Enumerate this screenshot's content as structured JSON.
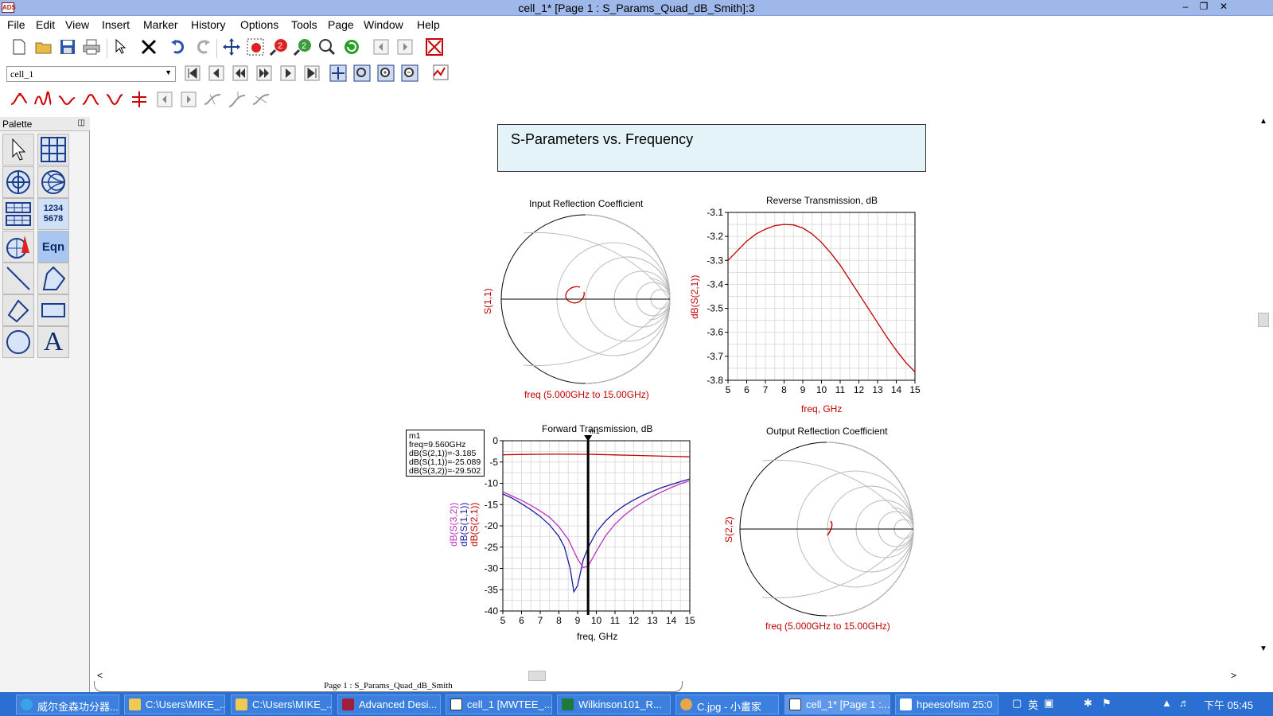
{
  "window": {
    "title": "cell_1* [Page 1 : S_Params_Quad_dB_Smith]:3",
    "app_icon": "ADS"
  },
  "menu": [
    "File",
    "Edit",
    "View",
    "Insert",
    "Marker",
    "History",
    "Options",
    "Tools",
    "Page",
    "Window",
    "Help"
  ],
  "toolbar2": {
    "cell_select": "cell_1"
  },
  "palette": {
    "title": "Palette",
    "numeric_label_1": "1234",
    "numeric_label_2": "5678",
    "eqn_label": "Eqn",
    "text_label": "A"
  },
  "page": {
    "title": "S-Parameters vs. Frequency",
    "tab": "Page 1 : S_Params_Quad_dB_Smith"
  },
  "plots": {
    "s11": {
      "title": "Input Reflection Coefficient",
      "ylabel": "S(1,1)",
      "xlabel": "freq (5.000GHz to 15.00GHz)"
    },
    "s21": {
      "title": "Reverse Transmission, dB",
      "ylabel": "dB(S(2,1))",
      "xlabel": "freq, GHz"
    },
    "fwd": {
      "title": "Forward Transmission, dB",
      "xlabel": "freq, GHz",
      "ylabel1": "dB(S(3,2))",
      "ylabel2": "dB(S(1,1))",
      "ylabel3": "dB(S(2,1))",
      "marker_tag": "m1"
    },
    "s22": {
      "title": "Output Reflection Coefficient",
      "ylabel": "S(2,2)",
      "xlabel": "freq (5.000GHz to 15.00GHz)"
    }
  },
  "marker": {
    "name": "m1",
    "line1": "freq=9.560GHz",
    "line2": "dB(S(2,1))=-3.185",
    "line3": "dB(S(1,1))=-25.089",
    "line4": "dB(S(3,2))=-29.502"
  },
  "chart_data": [
    {
      "type": "line",
      "title": "Reverse Transmission, dB",
      "xlabel": "freq, GHz",
      "ylabel": "dB(S(2,1))",
      "xlim": [
        5,
        15
      ],
      "ylim": [
        -3.8,
        -3.1
      ],
      "xticks": [
        "5",
        "6",
        "7",
        "8",
        "9",
        "10",
        "11",
        "12",
        "13",
        "14",
        "15"
      ],
      "yticks": [
        "-3.1",
        "-3.2",
        "-3.3",
        "-3.4",
        "-3.5",
        "-3.6",
        "-3.7",
        "-3.8"
      ],
      "grid": true,
      "series": [
        {
          "name": "dB(S(2,1))",
          "color": "#c00000",
          "x": [
            5,
            5.5,
            6,
            6.5,
            7,
            7.5,
            8,
            8.5,
            9,
            9.5,
            10,
            10.5,
            11,
            11.5,
            12,
            12.5,
            13,
            13.5,
            14,
            14.5,
            15
          ],
          "y": [
            -3.3,
            -3.26,
            -3.22,
            -3.19,
            -3.17,
            -3.155,
            -3.15,
            -3.152,
            -3.165,
            -3.19,
            -3.225,
            -3.27,
            -3.32,
            -3.38,
            -3.44,
            -3.5,
            -3.56,
            -3.62,
            -3.675,
            -3.725,
            -3.765
          ]
        }
      ]
    },
    {
      "type": "line",
      "title": "Forward Transmission, dB",
      "xlabel": "freq, GHz",
      "xlim": [
        5,
        15
      ],
      "ylim": [
        -40,
        0
      ],
      "xticks": [
        "5",
        "6",
        "7",
        "8",
        "9",
        "10",
        "11",
        "12",
        "13",
        "14",
        "15"
      ],
      "yticks": [
        "0",
        "-5",
        "-10",
        "-15",
        "-20",
        "-25",
        "-30",
        "-35",
        "-40"
      ],
      "grid": true,
      "marker_x": 9.56,
      "series": [
        {
          "name": "dB(S(2,1))",
          "color": "#c00000",
          "x": [
            5,
            6,
            7,
            8,
            9,
            9.56,
            10,
            11,
            12,
            13,
            14,
            15
          ],
          "y": [
            -3.3,
            -3.22,
            -3.17,
            -3.15,
            -3.17,
            -3.185,
            -3.22,
            -3.32,
            -3.44,
            -3.56,
            -3.67,
            -3.77
          ]
        },
        {
          "name": "dB(S(1,1))",
          "color": "#1a1aa0",
          "x": [
            5,
            5.5,
            6,
            6.5,
            7,
            7.5,
            8,
            8.3,
            8.6,
            8.8,
            9,
            9.3,
            9.56,
            10,
            10.5,
            11,
            11.5,
            12,
            12.5,
            13,
            13.5,
            14,
            14.5,
            15
          ],
          "y": [
            -12.5,
            -13.5,
            -14.8,
            -16.2,
            -17.8,
            -19.8,
            -22.5,
            -25,
            -30,
            -35.5,
            -34,
            -28,
            -25.1,
            -21.5,
            -18.8,
            -16.8,
            -15.2,
            -13.9,
            -12.8,
            -11.9,
            -11.0,
            -10.3,
            -9.6,
            -9.0
          ]
        },
        {
          "name": "dB(S(3,2))",
          "color": "#c030c0",
          "x": [
            5,
            5.5,
            6,
            6.5,
            7,
            7.5,
            8,
            8.5,
            9,
            9.3,
            9.56,
            10,
            10.5,
            11,
            11.5,
            12,
            12.5,
            13,
            13.5,
            14,
            14.5,
            15
          ],
          "y": [
            -12,
            -13,
            -14,
            -15.2,
            -16.5,
            -18,
            -20.2,
            -23.2,
            -27.8,
            -29.8,
            -29.5,
            -26,
            -22.3,
            -19.6,
            -17.5,
            -15.8,
            -14.4,
            -13.1,
            -12.0,
            -11.0,
            -10.1,
            -9.4
          ]
        }
      ]
    }
  ],
  "taskbar": {
    "items": [
      "威尔金森功分器...",
      "C:\\Users\\MIKE_...",
      "C:\\Users\\MIKE_...",
      "Advanced Desi...",
      "cell_1 [MWTEE_...",
      "Wilkinson101_R...",
      "C.jpg - 小畫家",
      "cell_1* [Page 1 :...",
      "hpeesofsim 25:0"
    ],
    "lang": "英",
    "clock": "下午 05:45"
  }
}
